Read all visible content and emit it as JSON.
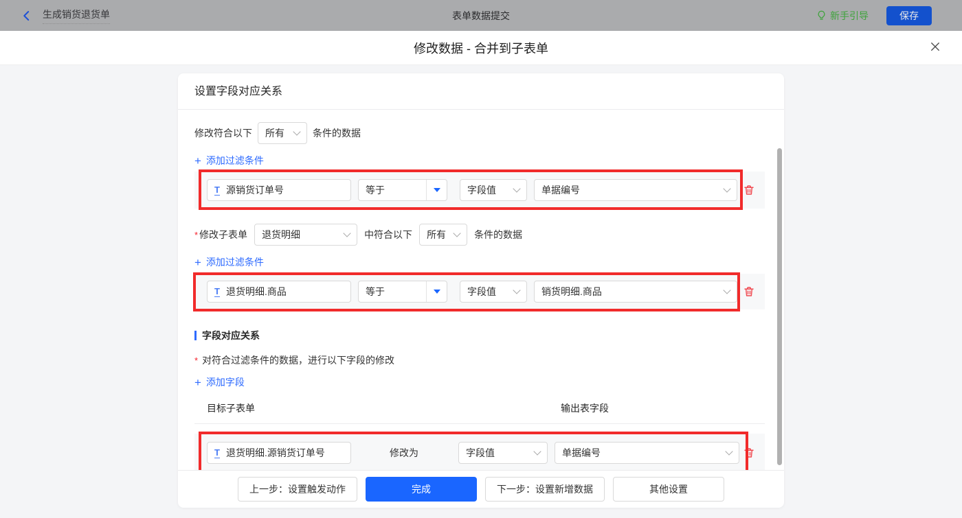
{
  "topbar": {
    "back_label": "生成销货退货单",
    "title": "表单数据提交",
    "guide_label": "新手引导",
    "save_label": "保存"
  },
  "modal": {
    "title": "修改数据 - 合并到子表单"
  },
  "panel": {
    "header": "设置字段对应关系",
    "main_filter": {
      "prefix": "修改符合以下",
      "match_value": "所有",
      "suffix": "条件的数据",
      "add_label": "添加过滤条件",
      "row": {
        "field": "源销货订单号",
        "operator": "等于",
        "value_type": "字段值",
        "value": "单据编号"
      }
    },
    "sub_filter": {
      "label": "修改子表单",
      "subform_value": "退货明细",
      "middle": "中符合以下",
      "match_value": "所有",
      "suffix": "条件的数据",
      "add_label": "添加过滤条件",
      "row": {
        "field": "退货明细.商品",
        "operator": "等于",
        "value_type": "字段值",
        "value": "销货明细.商品"
      }
    },
    "mapping": {
      "title": "字段对应关系",
      "desc": "对符合过滤条件的数据，进行以下字段的修改",
      "add_label": "添加字段",
      "col_left": "目标子表单",
      "col_right": "输出表字段",
      "row": {
        "field": "退货明细.源销货订单号",
        "middle": "修改为",
        "value_type": "字段值",
        "value": "单据编号"
      }
    },
    "footer": {
      "prev_label": "上一步：设置触发动作",
      "done_label": "完成",
      "next_label": "下一步：设置新增数据",
      "other_label": "其他设置"
    }
  },
  "icons": {
    "plus": "+",
    "required_mark": "*",
    "field_type_text": "T"
  },
  "colors": {
    "accent_blue": "#1a66ff",
    "link_blue": "#2e6bff",
    "save_blue": "#1351cd",
    "guide_green": "#3fa33c",
    "annotation_red": "#f12b2b",
    "trash_red": "#f0484f"
  }
}
